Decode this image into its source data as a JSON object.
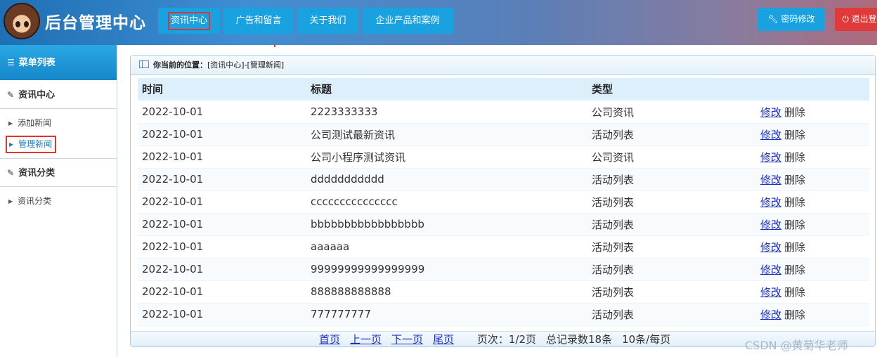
{
  "header": {
    "title": "后台管理中心",
    "nav": [
      "资讯中心",
      "广告和留言",
      "关于我们",
      "企业产品和案例"
    ],
    "password_btn": "密码修改",
    "logout_btn": "退出登"
  },
  "sidebar": {
    "menu_title": "菜单列表",
    "groups": [
      {
        "title": "资讯中心",
        "items": [
          "添加新闻",
          "管理新闻"
        ]
      },
      {
        "title": "资讯分类",
        "items": [
          "资讯分类"
        ]
      }
    ]
  },
  "breadcrumb": {
    "label": "你当前的位置：",
    "path": "[资讯中心]-[管理新闻]"
  },
  "table": {
    "headers": [
      "时间",
      "标题",
      "类型",
      ""
    ],
    "rows": [
      [
        "2022-10-01",
        "2223333333",
        "公司资讯"
      ],
      [
        "2022-10-01",
        "公司测试最新资讯",
        "活动列表"
      ],
      [
        "2022-10-01",
        "公司小程序测试资讯",
        "公司资讯"
      ],
      [
        "2022-10-01",
        "ddddddddddd",
        "活动列表"
      ],
      [
        "2022-10-01",
        "ccccccccccccccc",
        "活动列表"
      ],
      [
        "2022-10-01",
        "bbbbbbbbbbbbbbbbb",
        "活动列表"
      ],
      [
        "2022-10-01",
        "aaaaaa",
        "活动列表"
      ],
      [
        "2022-10-01",
        "99999999999999999",
        "活动列表"
      ],
      [
        "2022-10-01",
        "888888888888",
        "活动列表"
      ],
      [
        "2022-10-01",
        "777777777",
        "活动列表"
      ]
    ],
    "edit_label": "修改",
    "delete_label": "删除"
  },
  "pager": {
    "first": "首页",
    "prev": "上一页",
    "next": "下一页",
    "last": "尾页",
    "page_info": "页次：1/2页",
    "total": "总记录数18条",
    "per_page": "10条/每页"
  },
  "watermark": "CSDN @黄菊华老师"
}
